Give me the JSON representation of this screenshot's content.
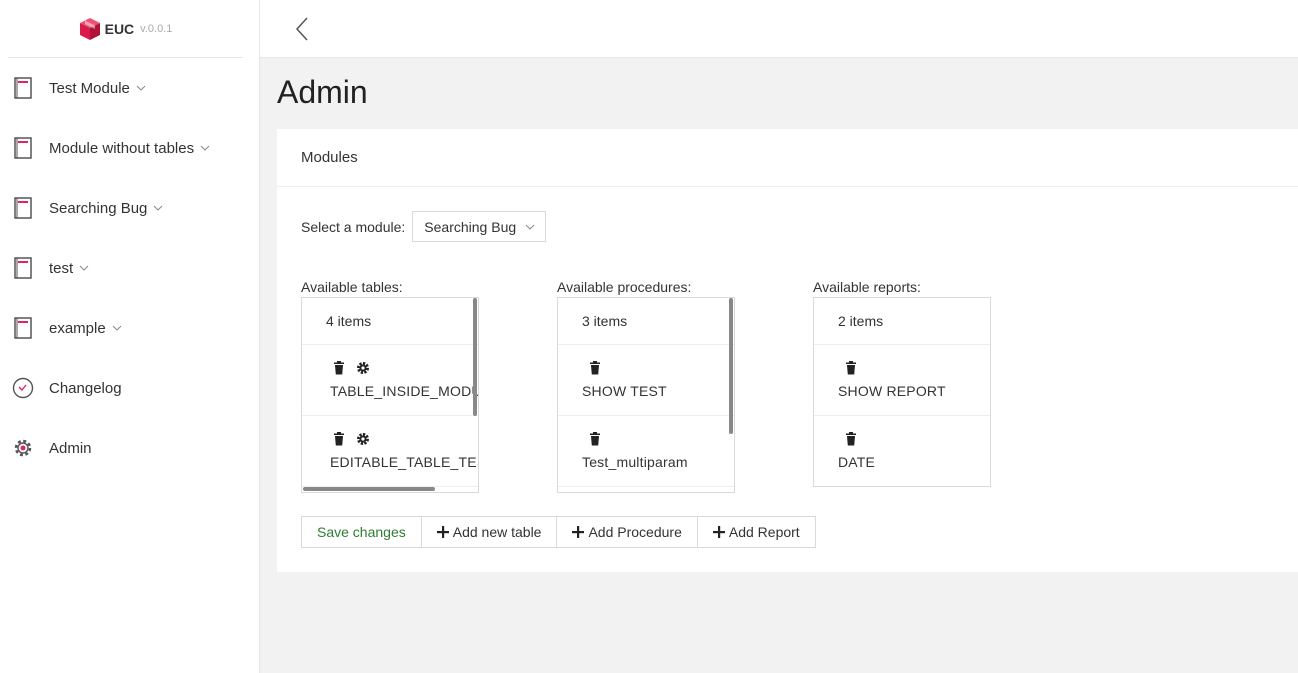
{
  "brand": {
    "name": "EUC",
    "version": "v.0.0.1"
  },
  "sidebar": {
    "items": [
      {
        "label": "Test Module",
        "icon": "module-icon",
        "expandable": true
      },
      {
        "label": "Module without tables",
        "icon": "module-icon",
        "expandable": true
      },
      {
        "label": "Searching Bug",
        "icon": "module-icon",
        "expandable": true
      },
      {
        "label": "test",
        "icon": "module-icon",
        "expandable": true
      },
      {
        "label": "example",
        "icon": "module-icon",
        "expandable": true
      },
      {
        "label": "Changelog",
        "icon": "clock-icon",
        "expandable": false
      },
      {
        "label": "Admin",
        "icon": "gear-icon",
        "expandable": false
      }
    ]
  },
  "page": {
    "title": "Admin"
  },
  "card": {
    "title": "Modules"
  },
  "module_select": {
    "label": "Select a module:",
    "value": "Searching Bug"
  },
  "tables": {
    "label": "Available tables:",
    "count": "4 items",
    "items": [
      "TABLE_INSIDE_MODULE",
      "EDITABLE_TABLE_TEST"
    ]
  },
  "procedures": {
    "label": "Available procedures:",
    "count": "3 items",
    "items": [
      "SHOW TEST",
      "Test_multiparam"
    ]
  },
  "reports": {
    "label": "Available reports:",
    "count": "2 items",
    "items": [
      "SHOW REPORT",
      "DATE"
    ]
  },
  "buttons": {
    "save": "Save changes",
    "add_table": "Add new table",
    "add_procedure": "Add Procedure",
    "add_report": "Add Report"
  },
  "colors": {
    "brand_red": "#e0245e",
    "save_green": "#2e7d32",
    "background": "#f2f2f2"
  }
}
